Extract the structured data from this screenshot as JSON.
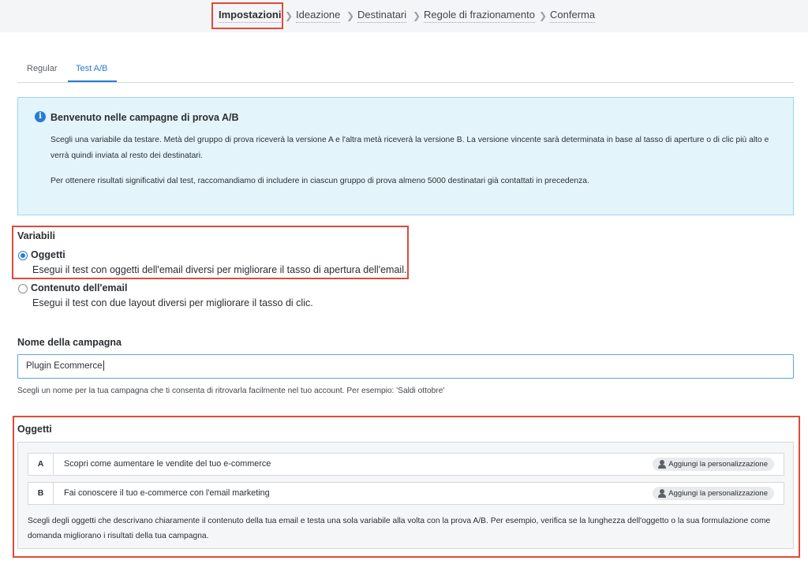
{
  "stepper": {
    "steps": [
      {
        "label": "Impostazioni",
        "active": true
      },
      {
        "label": "Ideazione",
        "active": false
      },
      {
        "label": "Destinatari",
        "active": false
      },
      {
        "label": "Regole di frazionamento",
        "active": false
      },
      {
        "label": "Conferma",
        "active": false
      }
    ],
    "separator_icon": "chevron-right-icon"
  },
  "tabs": [
    {
      "label": "Regular",
      "active": false
    },
    {
      "label": "Test A/B",
      "active": true
    }
  ],
  "info": {
    "icon": "info-icon",
    "title": "Benvenuto nelle campagne di prova A/B",
    "paragraph1": "Scegli una variabile da testare. Metà del gruppo di prova riceverà la versione A e l'altra metà riceverà la versione B. La versione vincente sarà determinata in base al tasso di aperture o di clic più alto e verrà quindi inviata al resto dei destinatari.",
    "paragraph2": "Per ottenere risultati significativi dal test, raccomandiamo di includere in ciascun gruppo di prova almeno 5000 destinatari già contattati in precedenza."
  },
  "variables": {
    "label": "Variabili",
    "options": [
      {
        "title": "Oggetti",
        "description": "Esegui il test con oggetti dell'email diversi per migliorare il tasso di apertura dell'email.",
        "selected": true
      },
      {
        "title": "Contenuto dell'email",
        "description": "Esegui il test con due layout diversi per migliorare il tasso di clic.",
        "selected": false
      }
    ]
  },
  "campaign_name": {
    "label": "Nome della campagna",
    "value": "Plugin Ecommerce",
    "help": "Scegli un nome per la tua campagna che ti consenta di ritrovarla facilmente nel tuo account. Per esempio: 'Saldi ottobre'"
  },
  "subjects": {
    "label": "Oggetti",
    "rows": [
      {
        "letter": "A",
        "text": "Scopri come aumentare le vendite del tuo e-commerce",
        "button": "Aggiungi la personalizzazione"
      },
      {
        "letter": "B",
        "text": "Fai conoscere il tuo e-commerce con l'email marketing",
        "button": "Aggiungi la personalizzazione"
      }
    ],
    "help": "Scegli degli oggetti che descrivano chiaramente il contenuto della tua email e testa una sola variabile alla volta con la prova A/B. Per esempio, verifica se la lunghezza dell'oggetto o la sua formulazione come domanda migliorano i risultati della tua campagna."
  },
  "colors": {
    "accent": "#2b7bd6",
    "highlight": "#e04a3a",
    "info_bg": "#e3f5fb"
  }
}
